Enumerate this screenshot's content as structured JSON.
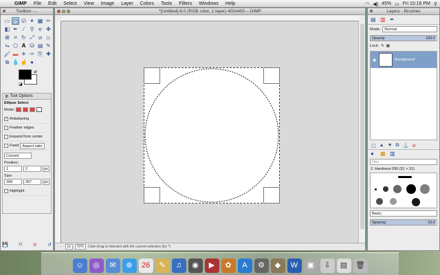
{
  "menubar": {
    "app": "GIMP",
    "items": [
      "File",
      "Edit",
      "Select",
      "View",
      "Image",
      "Layer",
      "Colors",
      "Tools",
      "Filters",
      "Windows",
      "Help"
    ],
    "battery": "45%",
    "clock": "Fri 10:16 PM"
  },
  "toolbox": {
    "title": "Toolbox -...",
    "tab_label": "Tool Options",
    "tool_name": "Ellipse Select",
    "mode_label": "Mode:",
    "antialiasing": "Antialiasing",
    "feather": "Feather edges",
    "expand": "Expand from center",
    "fixed": "Fixed",
    "fixed_value": "Aspect ratio",
    "current": "Current",
    "position_label": "Position:",
    "pos_x": "1",
    "pos_y": "2",
    "pos_unit": "px",
    "size_label": "Size:",
    "size_w": "399",
    "size_h": "397",
    "size_unit": "px",
    "highlight": "Highlight",
    "colors": {
      "fg": "#000000",
      "bg": "#ffffff"
    }
  },
  "image_window": {
    "title": "*[Untitled]-8.0 (RGB color, 1 layer) 400x400 – GIMP",
    "status_unit": "px",
    "status_zoom": "50%",
    "status_msg": "Click-Drag to intersect with the current selection (try ^)"
  },
  "dock": {
    "title": "Layers - Brushes",
    "mode_label": "Mode:",
    "mode_value": "Normal",
    "opacity_label": "Opacity",
    "opacity_value": "100.0",
    "lock_label": "Lock:",
    "layer_name": "Background",
    "filter_placeholder": "filter",
    "brush_name": "2. Hardness 050 (51 × 51)",
    "brush_tag": "Basic,",
    "spacing_label": "Spacing",
    "spacing_value": "10.0"
  }
}
